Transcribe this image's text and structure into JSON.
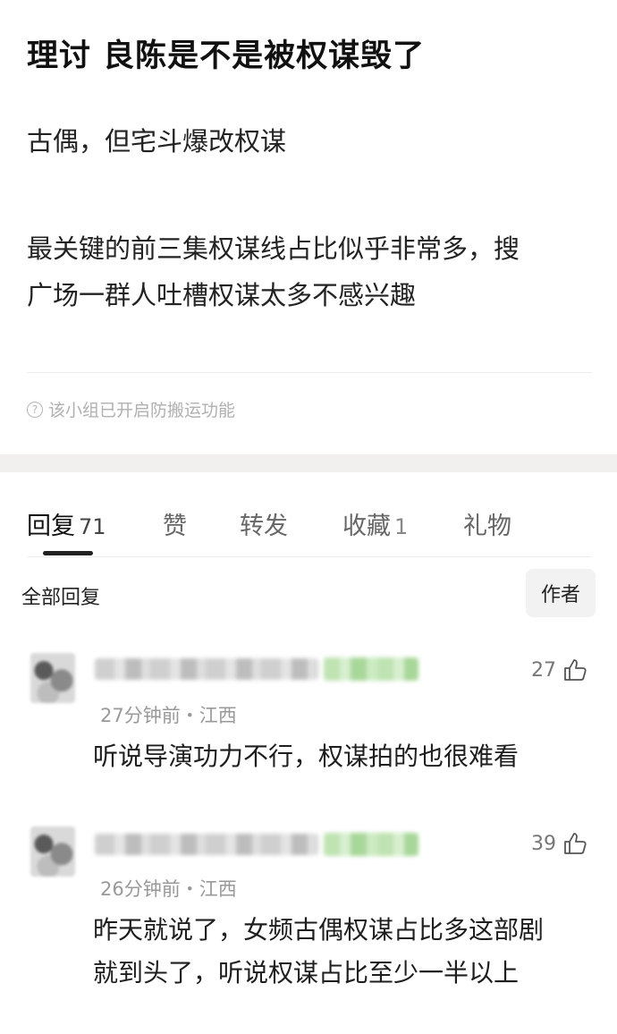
{
  "post": {
    "title": "理讨 良陈是不是被权谋毁了",
    "para1": "古偶，但宅斗爆改权谋",
    "para2_line1": "最关键的前三集权谋线占比似乎非常多，搜",
    "para2_line2": "广场一群人吐槽权谋太多不感兴趣",
    "notice": "该小组已开启防搬运功能",
    "notice_icon": "question-circle-icon"
  },
  "tabs": [
    {
      "label": "回复",
      "count": "71",
      "active": true
    },
    {
      "label": "赞",
      "count": "",
      "active": false
    },
    {
      "label": "转发",
      "count": "",
      "active": false
    },
    {
      "label": "收藏",
      "count": "1",
      "active": false
    },
    {
      "label": "礼物",
      "count": "",
      "active": false
    }
  ],
  "filter": {
    "label": "全部回复",
    "author_button": "作者"
  },
  "comments": [
    {
      "likes": "27",
      "meta": "27分钟前・江西",
      "line1": "听说导演功力不行，权谋拍的也很难看",
      "line2": ""
    },
    {
      "likes": "39",
      "meta": "26分钟前・江西",
      "line1": "昨天就说了，女频古偶权谋占比多这部剧",
      "line2": "就到头了，听说权谋占比至少一半以上"
    }
  ],
  "colors": {
    "accent_tag": "#a8d79a",
    "band": "#f1f0ee",
    "muted": "#999999"
  }
}
